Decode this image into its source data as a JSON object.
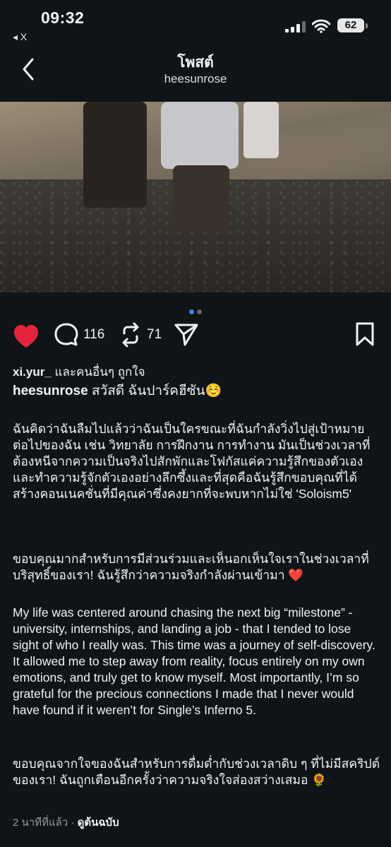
{
  "status": {
    "time": "09:32",
    "back_app": "◂ X",
    "battery": "62"
  },
  "nav": {
    "title": "โพสต์",
    "subtitle": "heesunrose"
  },
  "actions": {
    "comments_count": "116",
    "reposts_count": "71"
  },
  "post": {
    "likes_user": "xi.yur_",
    "likes_rest": " และคนอื่นๆ ถูกใจ",
    "caption_user": "heesunrose",
    "caption_text": "สวัสดี ฉันปาร์คฮีซัน☺️",
    "paragraph_1": "ฉันคิดว่าฉันลืมไปแล้วว่าฉันเป็นใครขณะที่ฉันกำลังวิ่งไปสู่เป้าหมายต่อไปของฉัน เช่น วิทยาลัย การฝึกงาน การทำงาน มันเป็นช่วงเวลาที่ต้องหนีจากความเป็นจริงไปสักพักและโฟกัสแค่ความรู้สึกของตัวเองและทำความรู้จักตัวเองอย่างลึกซึ้งและที่สุดคือฉันรู้สึกขอบคุณที่ได้สร้างคอนเนคชั่นที่มีคุณค่าซึ่งคงยากที่จะพบหากไม่ใช่ 'Soloism5'",
    "paragraph_2": "ขอบคุณมากสำหรับการมีส่วนร่วมและเห็นอกเห็นใจเราในช่วงเวลาที่บริสุทธิ์ของเรา! ฉันรู้สึกว่าความจริงกำลังผ่านเข้ามา ❤️",
    "paragraph_3": " My life was centered around chasing the next big “milestone” - university, internships, and landing a job - that I tended to lose sight of who I really was. This time was a journey of self-discovery. It allowed me to step away from reality, focus entirely on my own emotions, and truly get to know myself. Most importantly, I’m so grateful for the precious connections I made that I never would have found if it weren’t for Single’s Inferno 5.",
    "paragraph_4": "ขอบคุณจากใจของฉันสำหรับการดื่มด่ำกับช่วงเวลาดิบ ๆ ที่ไม่มีสคริปต์ของเรา! ฉันถูกเตือนอีกครั้งว่าความจริงใจส่องสว่างเสมอ 🌻",
    "time_ago": "2 นาทีที่แล้ว",
    "separator": " · ",
    "see_original": "ดูต้นฉบับ"
  },
  "colors": {
    "background": "#0f1418",
    "like_red": "#e5243b",
    "carousel_active": "#3b82f6"
  },
  "icons": [
    "back-chevron-icon",
    "signal-icon",
    "wifi-icon",
    "mute-icon",
    "heart-icon",
    "comment-icon",
    "repost-icon",
    "share-icon",
    "bookmark-icon"
  ]
}
